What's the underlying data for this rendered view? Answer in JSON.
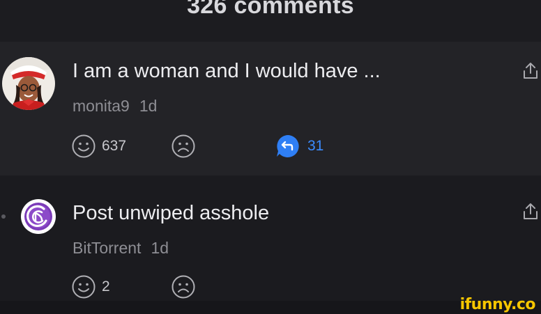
{
  "header": {
    "title": "326 comments"
  },
  "comments": [
    {
      "text": "I am a woman and I would have ...",
      "username": "monita9",
      "time": "1d",
      "smiles": "637",
      "replies": "31"
    },
    {
      "text": "Post unwiped asshole",
      "username": "BitTorrent",
      "time": "1d",
      "smiles": "2"
    }
  ],
  "watermark": "ifunny.co",
  "colors": {
    "accent": "#3b8cff",
    "background": "#1a1a1e",
    "muted": "#8e8e94",
    "watermark": "#f7c600"
  },
  "icons": [
    "smile-icon",
    "frown-icon",
    "reply-bubble-icon",
    "share-icon",
    "bittorrent-logo"
  ]
}
